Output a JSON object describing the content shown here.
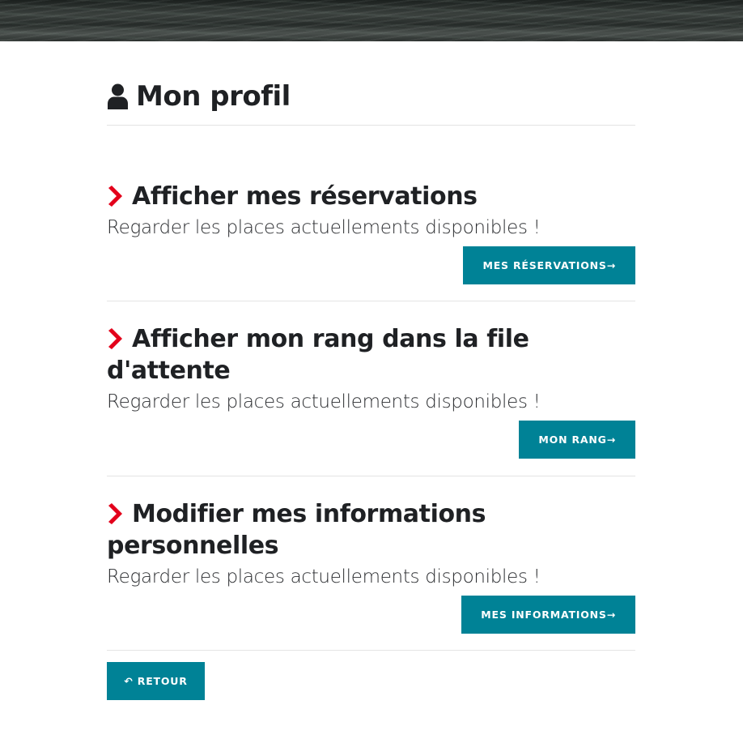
{
  "page": {
    "title": "Mon profil",
    "icon": "user-icon"
  },
  "sections": [
    {
      "title": "Afficher mes réservations",
      "description": "Regarder les places actuellements disponibles !",
      "button": "MES RÉSERVATIONS→"
    },
    {
      "title": "Afficher mon rang dans la file d'attente",
      "description": "Regarder les places actuellements disponibles !",
      "button": "MON RANG→"
    },
    {
      "title": "Modifier mes informations personnelles",
      "description": "Regarder les places actuellements disponibles !",
      "button": "MES INFORMATIONS→"
    }
  ],
  "back_button": "↶ RETOUR",
  "colors": {
    "accent": "#008296",
    "chevron": "#e3001b",
    "text": "#1f2124"
  }
}
